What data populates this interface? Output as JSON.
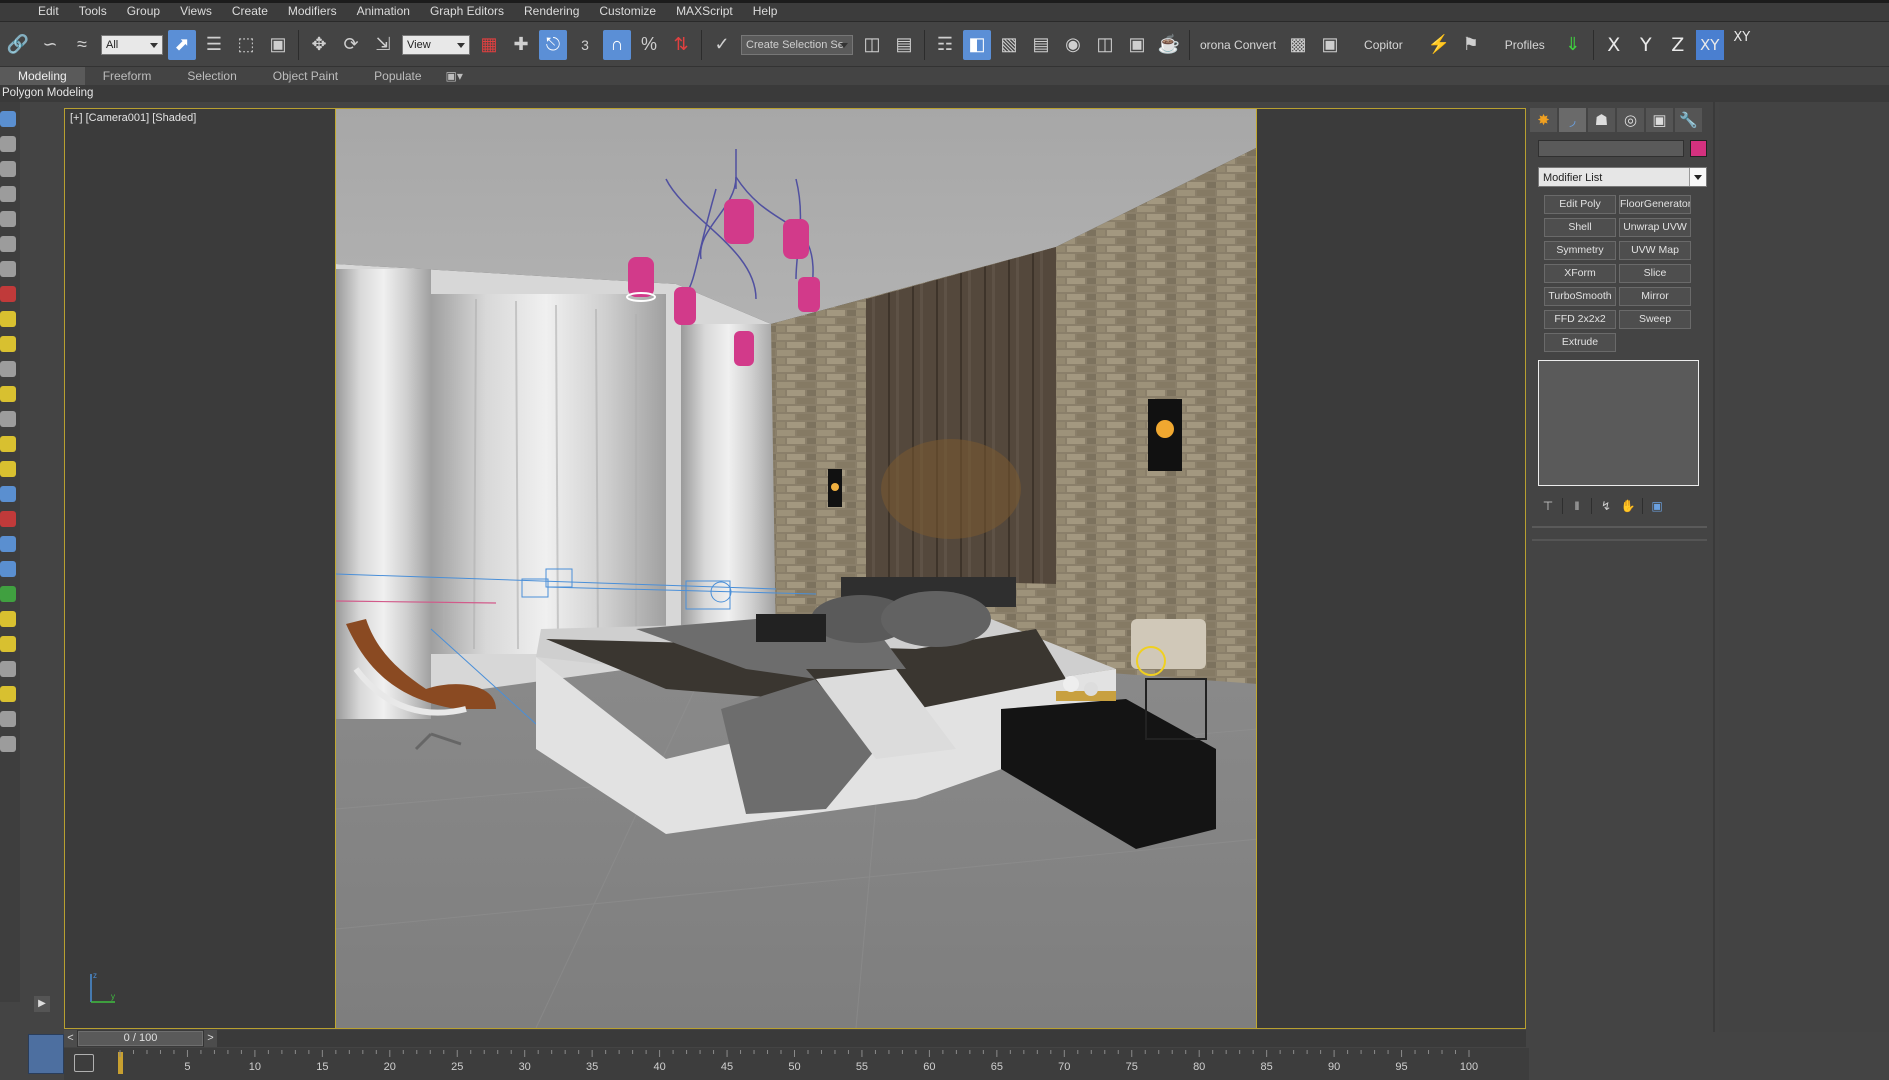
{
  "menu": {
    "items": [
      "Edit",
      "Tools",
      "Group",
      "Views",
      "Create",
      "Modifiers",
      "Animation",
      "Graph Editors",
      "Rendering",
      "Customize",
      "MAXScript",
      "Help"
    ]
  },
  "toolbar": {
    "selection_filter": "All",
    "reference_coord": "View",
    "snap_label": "3",
    "angle_snap_label": "%",
    "named_selection_placeholder": "Create Selection Se",
    "corona_convert_label": "orona Convert",
    "copitor_label": "Copitor",
    "profiles_label": "Profiles",
    "axis_x": "X",
    "axis_y": "Y",
    "axis_z": "Z",
    "axis_xy": "XY",
    "axis_xy2": "XY"
  },
  "ribbon": {
    "tabs": [
      "Modeling",
      "Freeform",
      "Selection",
      "Object Paint",
      "Populate"
    ],
    "active_tab": "Modeling",
    "subpanel": "Polygon Modeling"
  },
  "viewport": {
    "label": "[+] [Camera001] [Shaded]"
  },
  "command_panel": {
    "modifier_list_label": "Modifier List",
    "object_color": "#d4317f",
    "modifier_buttons": [
      "Edit Poly",
      "FloorGenerator",
      "Shell",
      "Unwrap UVW",
      "Symmetry",
      "UVW Map",
      "XForm",
      "Slice",
      "TurboSmooth",
      "Mirror",
      "FFD 2x2x2",
      "Sweep",
      "Extrude"
    ]
  },
  "timeline": {
    "frame_display": "0 / 100",
    "prev_label": "<",
    "next_label": ">",
    "ticks": [
      "5",
      "10",
      "15",
      "20",
      "25",
      "30",
      "35",
      "40",
      "45",
      "50",
      "55",
      "60",
      "65",
      "70",
      "75",
      "80",
      "85",
      "90",
      "95",
      "100"
    ]
  },
  "colors": {
    "accent_blue": "#5b8fd6",
    "viewport_border": "#b8a030",
    "chandelier": "#d23a8a"
  }
}
